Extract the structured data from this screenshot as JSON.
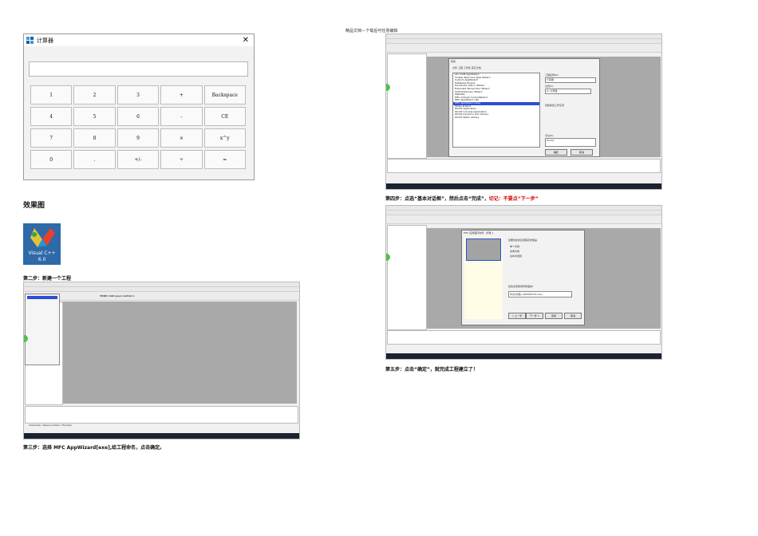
{
  "header_note": "精品文档---下载后可任意编辑",
  "calculator": {
    "title": "计算器",
    "close": "✕",
    "buttons": [
      "1",
      "2",
      "3",
      "+",
      "Backspace",
      "4",
      "5",
      "6",
      "-",
      "CE",
      "7",
      "8",
      "9",
      "×",
      "x^y",
      "0",
      ".",
      "+/-",
      "÷",
      "="
    ]
  },
  "sections": {
    "result_heading": "效果图",
    "logo_line1": "Visual C++",
    "logo_line2": "6.0",
    "step2": "第二步：新建一个工程",
    "step3": "第三步：选择 MFC AppWizard[exe],给工程命名，点击确定。",
    "step4_main": "第四步：点选“基本对话框”，然后点击“完成”，",
    "step4_red": "切记：不要点“下一步”",
    "step5": "第五步：点击“确定”，就完成工程建立了！"
  },
  "shot_a": {
    "toolbar_text": "TODO: Add your control n",
    "tabs": "ClassView / ResourceView / FileView"
  },
  "shot_b": {
    "dialog_title": "新建",
    "tabs": "文件  工程  工作区  其它文档",
    "items": [
      "ATL COM AppWizard",
      "Cluster Resource Type Wizard",
      "Custom AppWizard",
      "Database Project",
      "DevStudio Add-in Wizard",
      "Extended Stored Proc Wizard",
      "ISAPI Extension Wizard",
      "Makefile",
      "MFC ActiveX ControlWizard",
      "MFC AppWizard (dll)",
      "MFC AppWizard (exe)",
      "Utility Project",
      "Win32 Application",
      "Win32 Console Application",
      "Win32 Dynamic-Link Library",
      "Win32 Static Library"
    ],
    "project_name_label": "工程名称(N):",
    "project_name": "计算器",
    "location_label": "位置(C):",
    "location": "D:\\计算器",
    "create_new": "创建新的工作空间",
    "platform_label": "平台(P):",
    "platform": "Win32",
    "ok": "确定",
    "cancel": "取消"
  },
  "shot_c": {
    "dialog_title": "MFC 应用程序向导 - 步骤 1",
    "question": "您要创建的应用程序类型是:",
    "opt1": "单个文档",
    "opt2": "多重文档",
    "opt3": "基本对话框",
    "lang_label": "您的资源使用何种语言?",
    "lang": "中文[中国] (APPWZCHS.DLL)",
    "back": "< 上一步",
    "next": "下一步 >",
    "finish": "完成",
    "cancel": "取消"
  },
  "colors": {
    "accent_red": "#d40000",
    "list_select": "#2a4fd6",
    "ide_gray": "#a9a9a9"
  }
}
